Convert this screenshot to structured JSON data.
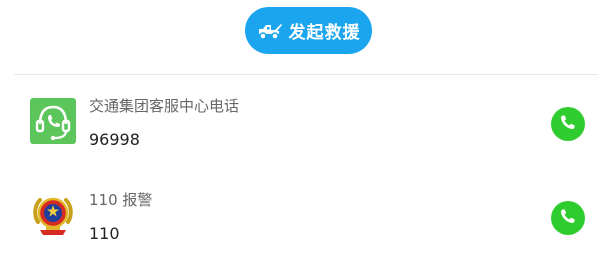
{
  "rescue_button": {
    "label": "发起救援",
    "icon": "tow-truck-icon",
    "color": "#1aa5ee"
  },
  "contacts": [
    {
      "name": "交通集团客服中心电话",
      "number": "96998",
      "icon": "headset-support-icon",
      "icon_color": "#5cc55c"
    },
    {
      "name": "110 报警",
      "number": "110",
      "icon": "police-emblem-icon"
    }
  ],
  "call_button_color": "#2fcc2f"
}
